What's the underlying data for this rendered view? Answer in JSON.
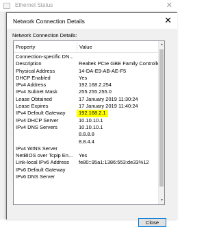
{
  "background_window": {
    "title": "Ethernet Status"
  },
  "dialog": {
    "title": "Network Connection Details",
    "section_label": "Network Connection Details:",
    "columns": {
      "property": "Property",
      "value": "Value"
    },
    "rows": [
      {
        "property": "Connection-specific DN...",
        "value": ""
      },
      {
        "property": "Description",
        "value": "Realtek PCIe GBE Family Controller"
      },
      {
        "property": "Physical Address",
        "value": "14-DA-E9-AB-AE-F5"
      },
      {
        "property": "DHCP Enabled",
        "value": "Yes"
      },
      {
        "property": "IPv4 Address",
        "value": "192.168.2.254"
      },
      {
        "property": "IPv4 Subnet Mask",
        "value": "255.255.255.0"
      },
      {
        "property": "Lease Obtained",
        "value": "17 January 2019 11:30:24"
      },
      {
        "property": "Lease Expires",
        "value": "17 January 2019 11:40:24"
      },
      {
        "property": "IPv4 Default Gateway",
        "value": "192.168.2.1",
        "highlight": true
      },
      {
        "property": "IPv4 DHCP Server",
        "value": "10.10.10.1"
      },
      {
        "property": "IPv4 DNS Servers",
        "value": "10.10.10.1"
      },
      {
        "property": "",
        "value": "8.8.8.8"
      },
      {
        "property": "",
        "value": "8.8.4.4"
      },
      {
        "property": "IPv4 WINS Server",
        "value": ""
      },
      {
        "property": "NetBIOS over Tcpip En...",
        "value": "Yes"
      },
      {
        "property": "Link-local IPv6 Address",
        "value": "fe80::95a1:1386:553:de33%12"
      },
      {
        "property": "IPv6 Default Gateway",
        "value": ""
      },
      {
        "property": "IPv6 DNS Server",
        "value": ""
      }
    ],
    "close_label": "Close",
    "highlight_color": "#ffff00"
  }
}
